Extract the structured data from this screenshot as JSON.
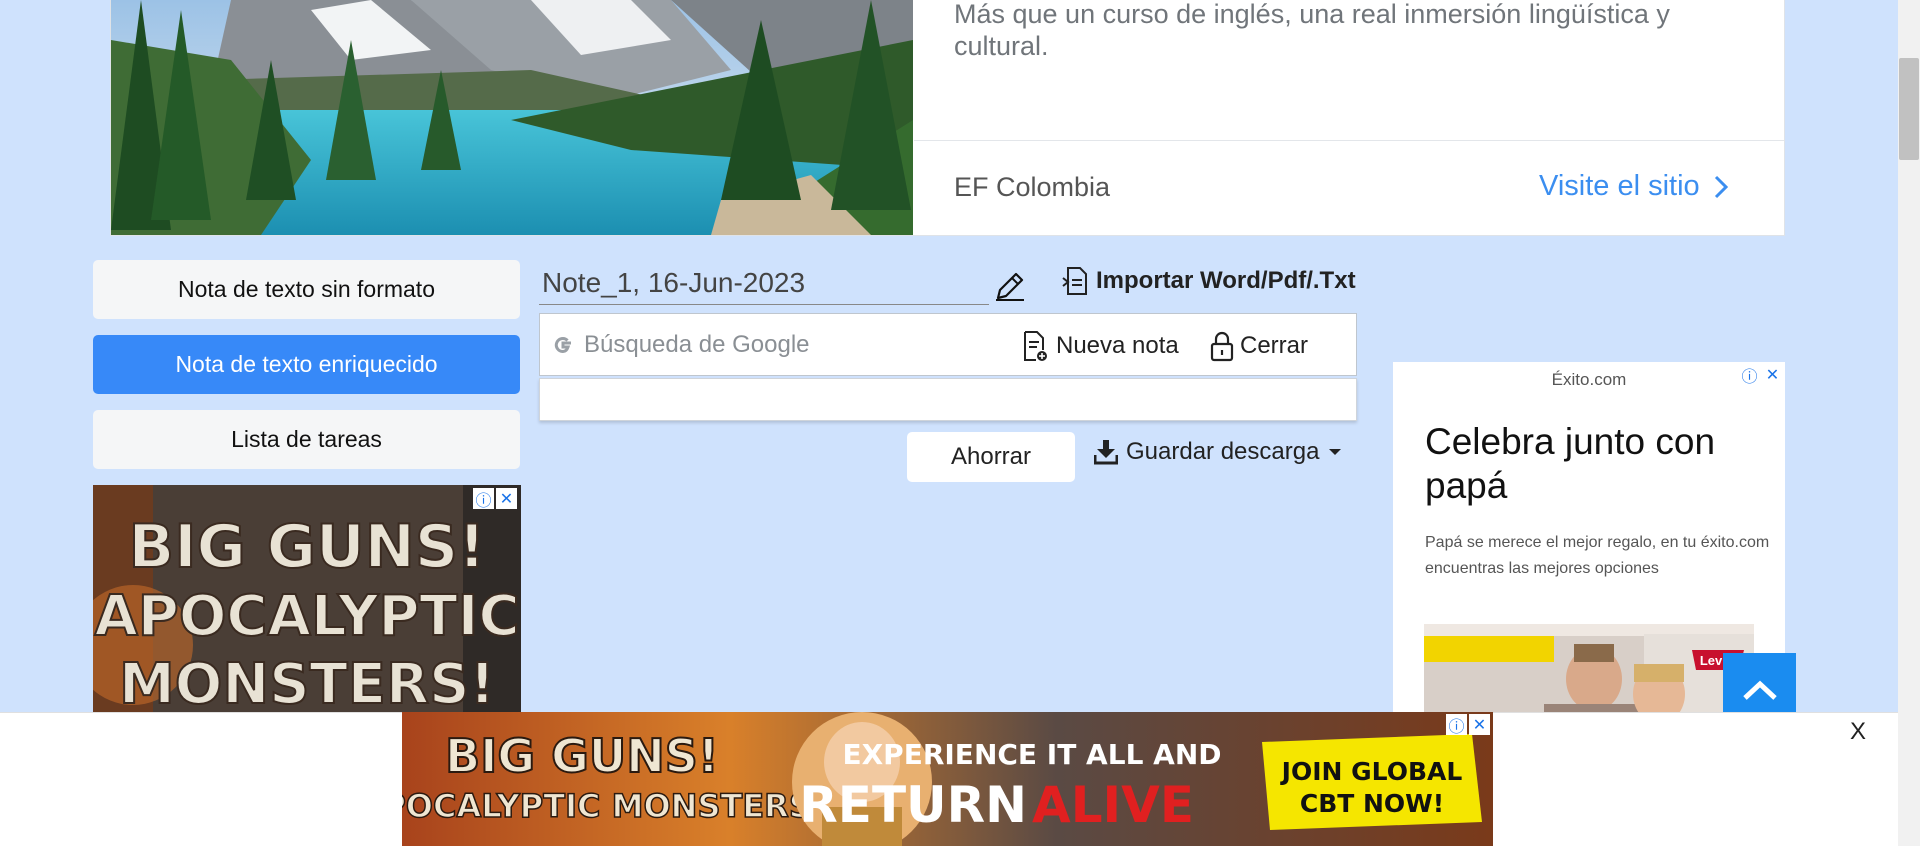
{
  "top_ad": {
    "description": "Más que un curso de inglés, una real inmersión lingüística y cultural.",
    "advertiser": "EF Colombia",
    "cta": "Visite el sitio"
  },
  "nav": {
    "items": [
      {
        "label": "Nota de texto sin formato",
        "active": false
      },
      {
        "label": "Nota de texto enriquecido",
        "active": true
      },
      {
        "label": "Lista de tareas",
        "active": false
      }
    ]
  },
  "left_ad": {
    "line1": "BIG GUNS!",
    "line2": "APOCALYPTIC",
    "line3": "MONSTERS!"
  },
  "note": {
    "title": "Note_1, 16-Jun-2023",
    "import_label": "Importar Word/Pdf/.Txt",
    "search_placeholder": "Búsqueda de Google",
    "new_note_label": "Nueva nota",
    "close_label": "Cerrar",
    "save_label": "Ahorrar",
    "download_label": "Guardar descarga"
  },
  "right_ad": {
    "brand": "Éxito.com",
    "headline": "Celebra junto con papá",
    "body": "Papá se merece el mejor regalo, en tu éxito.com encuentras las mejores opciones",
    "image_brand": "Levi's"
  },
  "bottom_ad": {
    "line1": "BIG GUNS!",
    "line2": "APOCALYPTIC MONSTERS!",
    "line3": "EXPERIENCE IT ALL AND",
    "line4a": "RETURN",
    "line4b": "ALIVE",
    "badge1": "JOIN GLOBAL",
    "badge2": "CBT NOW!",
    "close_label": "X"
  },
  "colors": {
    "accent": "#3789f8",
    "page_bg": "#cfe2fd",
    "link": "#3b8ef0"
  }
}
